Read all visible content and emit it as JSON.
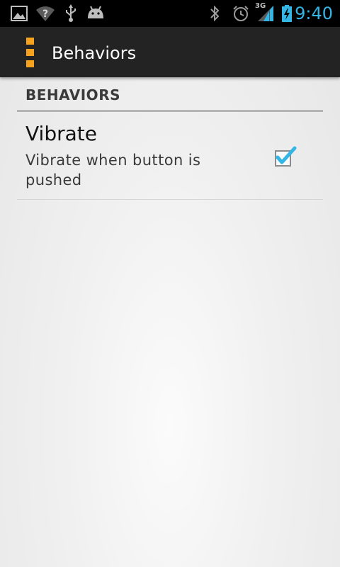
{
  "status_bar": {
    "time": "9:40",
    "network_label": "3G",
    "icons": [
      "gallery-icon",
      "wifi-unknown-icon",
      "usb-icon",
      "android-debug-icon",
      "bluetooth-icon",
      "alarm-icon",
      "signal-3g-icon",
      "battery-charging-icon"
    ],
    "time_color": "#33b5e5"
  },
  "action_bar": {
    "title": "Behaviors",
    "icon": "menu-dots-icon",
    "icon_color": "#f6a21e"
  },
  "preferences": {
    "category_title": "BEHAVIORS",
    "items": [
      {
        "title": "Vibrate",
        "summary": "Vibrate when button is pushed",
        "checked": true
      }
    ]
  }
}
